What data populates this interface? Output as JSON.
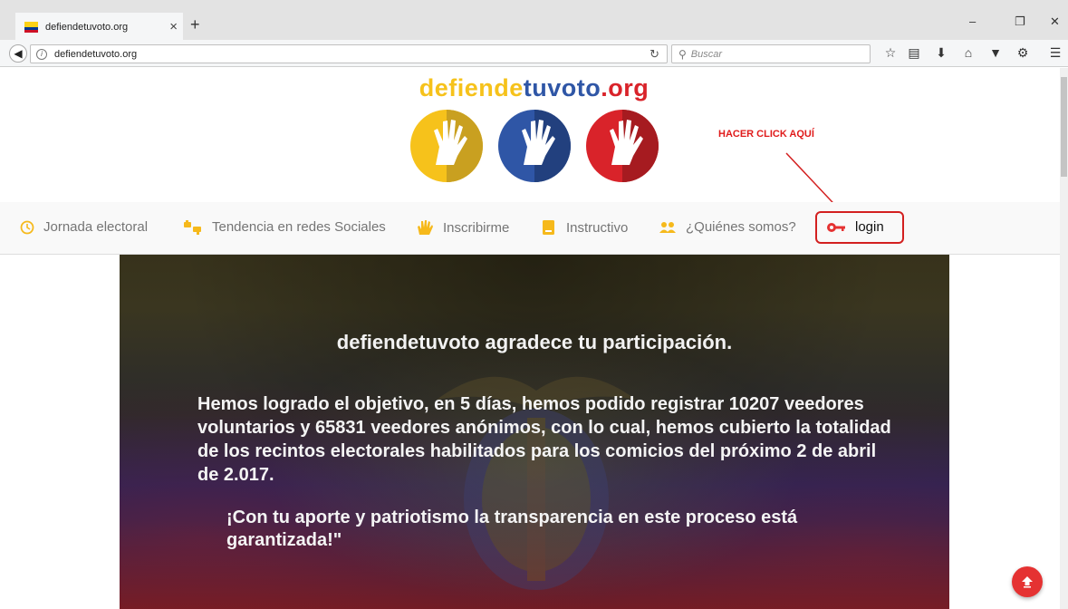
{
  "browser": {
    "tab_title": "defiendetuvoto.org",
    "tab_close": "×",
    "new_tab": "+",
    "url": "defiendetuvoto.org",
    "search_placeholder": "Buscar",
    "window_controls": {
      "minimize": "–",
      "restore": "❐",
      "close": "✕"
    },
    "toolbar_icons": [
      "star-icon",
      "reading-list-icon",
      "download-icon",
      "home-icon",
      "pocket-icon",
      "extension-icon",
      "menu-icon"
    ]
  },
  "site": {
    "logo": {
      "part1": "defiende",
      "part2": "tuvoto",
      "part3": ".org"
    },
    "annotation": "HACER CLICK AQUÍ",
    "menu": [
      {
        "label": "Jornada electoral",
        "icon": "clock-icon"
      },
      {
        "label": "Tendencia en redes Sociales",
        "icon": "thumbs-icon"
      },
      {
        "label": "Inscribirme",
        "icon": "hand-icon"
      },
      {
        "label": "Instructivo",
        "icon": "document-icon"
      },
      {
        "label": "¿Quiénes somos?",
        "icon": "people-icon"
      },
      {
        "label": "login",
        "icon": "key-icon"
      }
    ],
    "hero": {
      "title": "defiendetuvoto agradece tu participación.",
      "body": "Hemos logrado el objetivo, en 5 días, hemos podido registrar 10207 veedores voluntarios y 65831 veedores anónimos, con lo cual, hemos cubierto la totalidad de los recintos electorales habilitados para los comicios del próximo 2 de abril de 2.017.",
      "closing": "¡Con tu aporte y patriotismo la transparencia en este proceso está garantizada!\""
    }
  },
  "colors": {
    "logo_yellow": "#f6c21b",
    "logo_blue": "#2f56a6",
    "logo_red": "#d9232a",
    "menu_icon_yellow": "#f6b91b",
    "accent_red": "#d32020"
  }
}
